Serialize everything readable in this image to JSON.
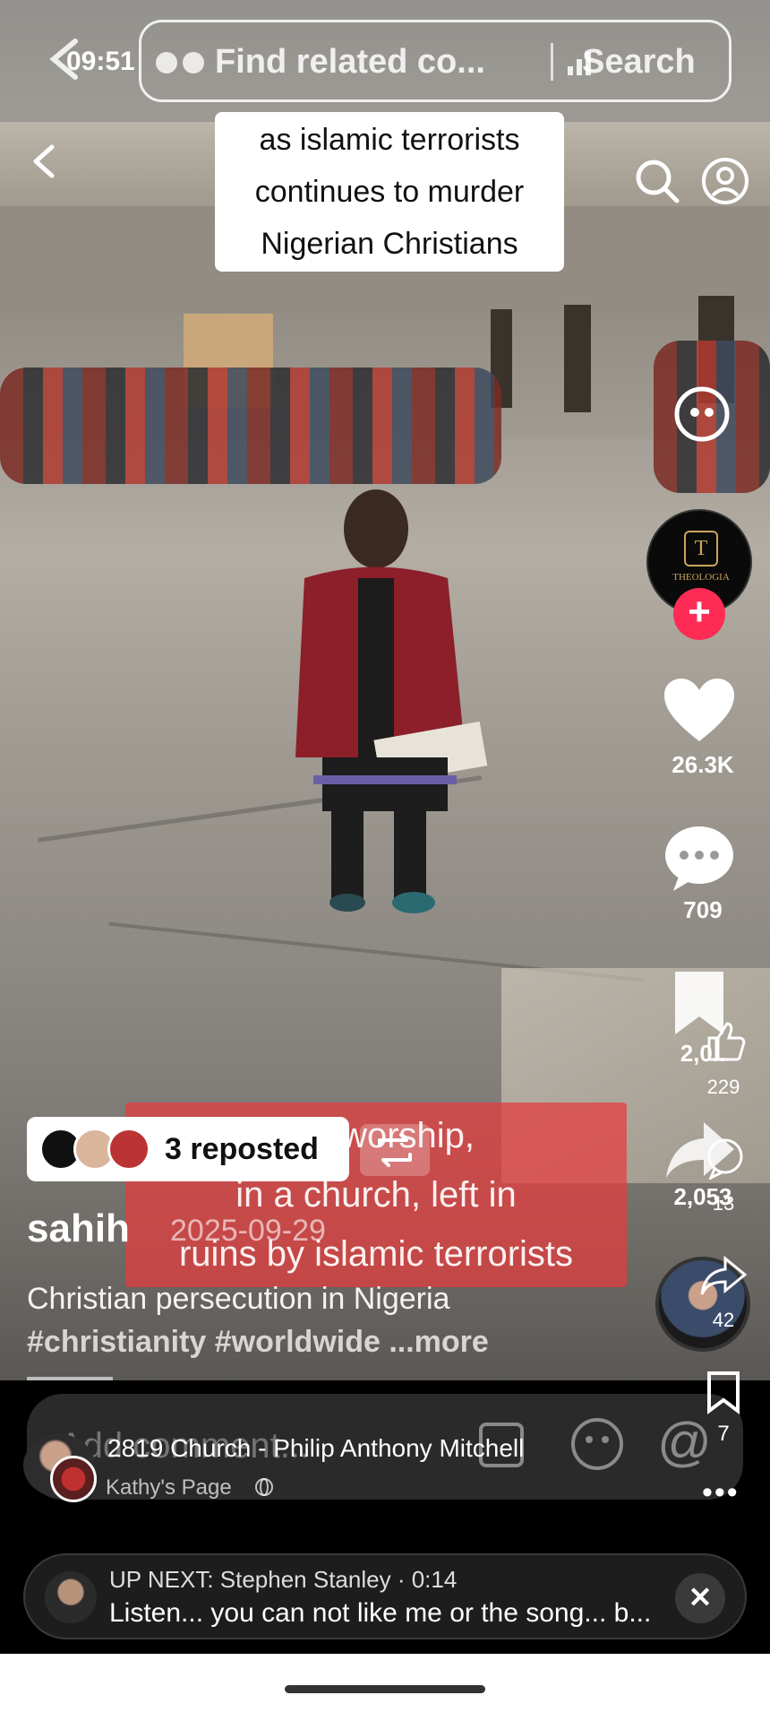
{
  "status_bar": {
    "time": "09:51"
  },
  "search": {
    "placeholder": "Find related co...",
    "action": "Search"
  },
  "video": {
    "caption_top": [
      "as islamic terrorists",
      "continues to murder",
      "Nigerian Christians"
    ],
    "caption_mid": [
      "...ill worship,",
      "in a church, left in",
      "ruins by islamic terrorists"
    ]
  },
  "side_actions": {
    "creator_badge": "THEOLOGIA",
    "likes": "26.3K",
    "comments": "709",
    "saves": "2,0..",
    "shares": "2,053",
    "fb_likes": "229",
    "fb_comments": "13",
    "fb_shares": "42",
    "fb_saves": "7"
  },
  "reposted": {
    "label": "3 reposted"
  },
  "post": {
    "username": "sahih",
    "date": "2025-09-29",
    "description": "Christian persecution in Nigeria",
    "hashtags": "#christianity #worldwide ...more"
  },
  "comment_bar": {
    "placeholder": "Add comment..."
  },
  "source": {
    "title": "2819 Church - Philip Anthony Mitchell",
    "page": "Kathy's Page"
  },
  "up_next": {
    "heading": "UP NEXT: Stephen Stanley · 0:14",
    "title": "Listen... you can not like me or the song... b..."
  },
  "colors": {
    "accent_pink": "#fe2c55",
    "caption_red": "#e63c3c"
  }
}
